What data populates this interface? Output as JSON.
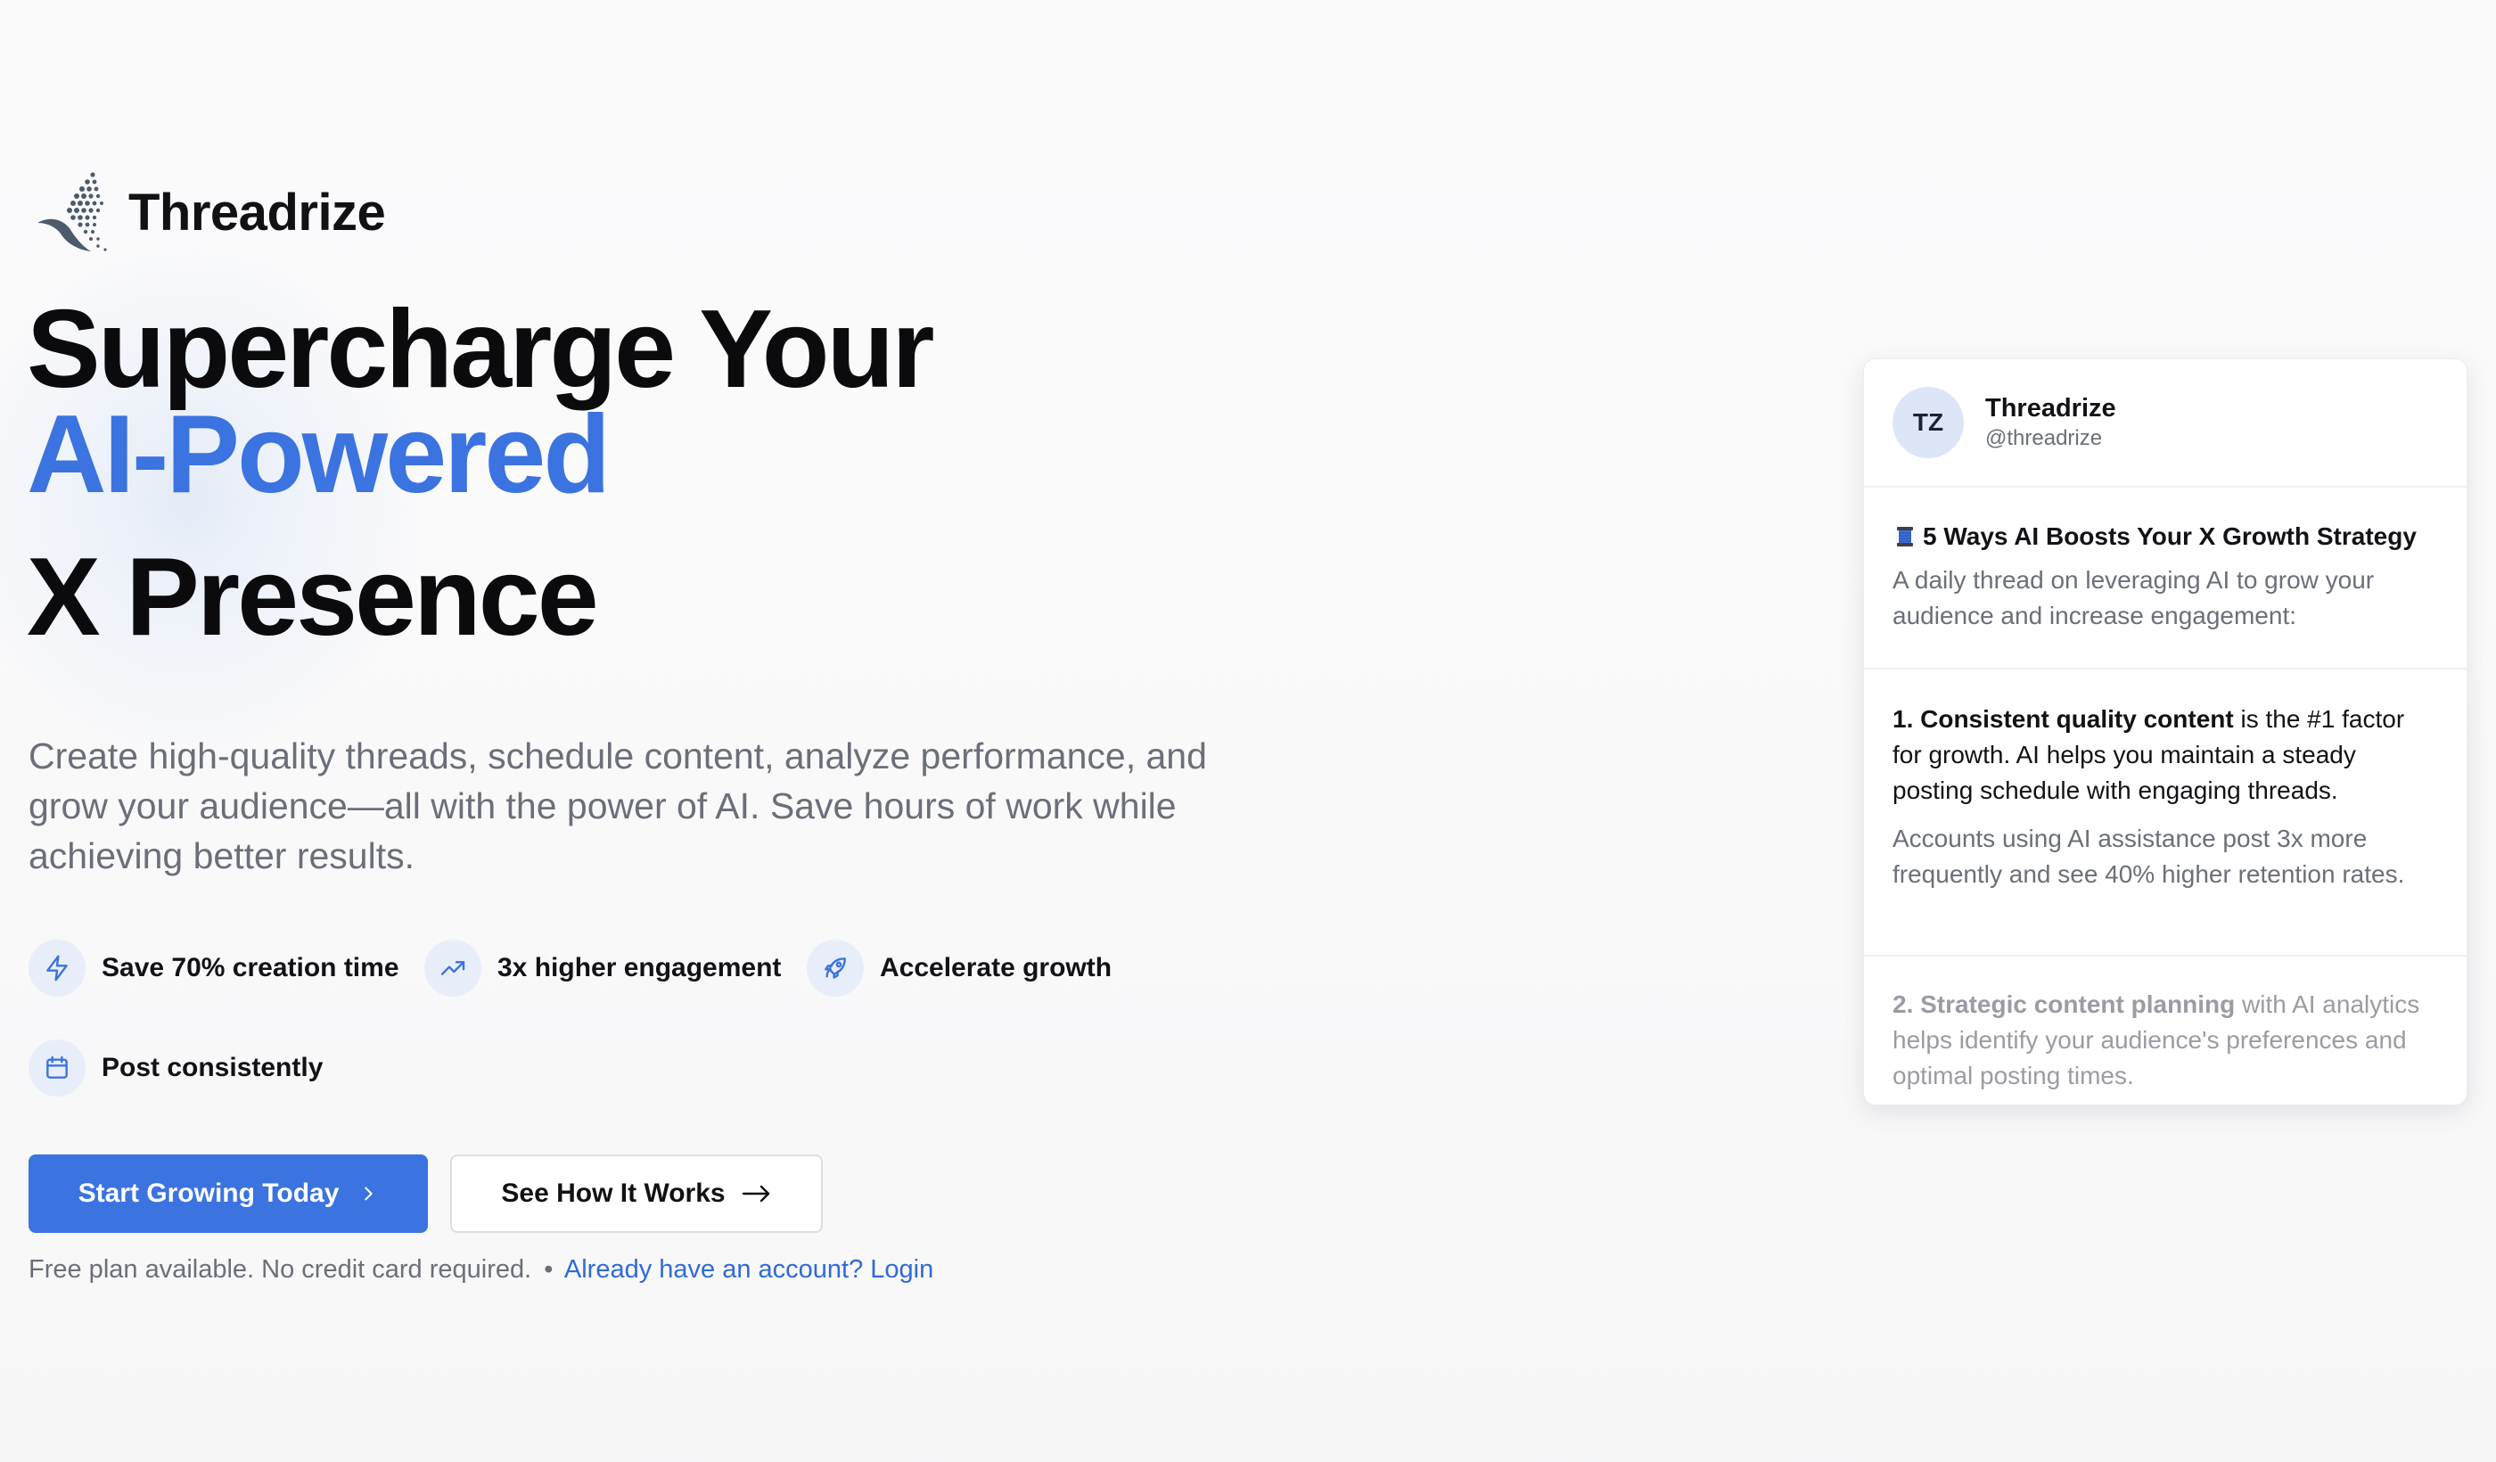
{
  "brand": {
    "name": "Threadrize"
  },
  "hero": {
    "headline_line1": "Supercharge Your",
    "headline_line2": "AI-Powered",
    "headline_line3": "X Presence",
    "subtitle": "Create high-quality threads, schedule content, analyze performance, and grow your audience—all with the power of AI. Save hours of work while achieving better results."
  },
  "features": [
    {
      "icon": "lightning-icon",
      "label": "Save 70% creation time"
    },
    {
      "icon": "trending-up-icon",
      "label": "3x higher engagement"
    },
    {
      "icon": "rocket-icon",
      "label": "Accelerate growth"
    },
    {
      "icon": "calendar-icon",
      "label": "Post consistently"
    }
  ],
  "cta": {
    "primary_label": "Start Growing Today",
    "secondary_label": "See How It Works",
    "footnote": "Free plan available. No credit card required.",
    "separator": "•",
    "login_link": "Already have an account? Login"
  },
  "thread_preview": {
    "avatar_initials": "TZ",
    "account_name": "Threadrize",
    "account_handle": "@threadrize",
    "post1_title": "5 Ways AI Boosts Your X Growth Strategy",
    "post1_text": "A daily thread on leveraging AI to grow your audience and increase engagement:",
    "post2_bold": "1. Consistent quality content",
    "post2_text": " is the #1 factor for growth. AI helps you maintain a steady posting schedule with engaging threads.",
    "post2_muted": "Accounts using AI assistance post 3x more frequently and see 40% higher retention rates.",
    "post3_bold": "2. Strategic content planning",
    "post3_text": " with AI analytics helps identify your audience's preferences and optimal posting times."
  },
  "colors": {
    "accent": "#3b73e0",
    "link": "#2f6ad8",
    "muted_text": "#6b6f78",
    "feature_icon_bg": "#e8eef9"
  }
}
